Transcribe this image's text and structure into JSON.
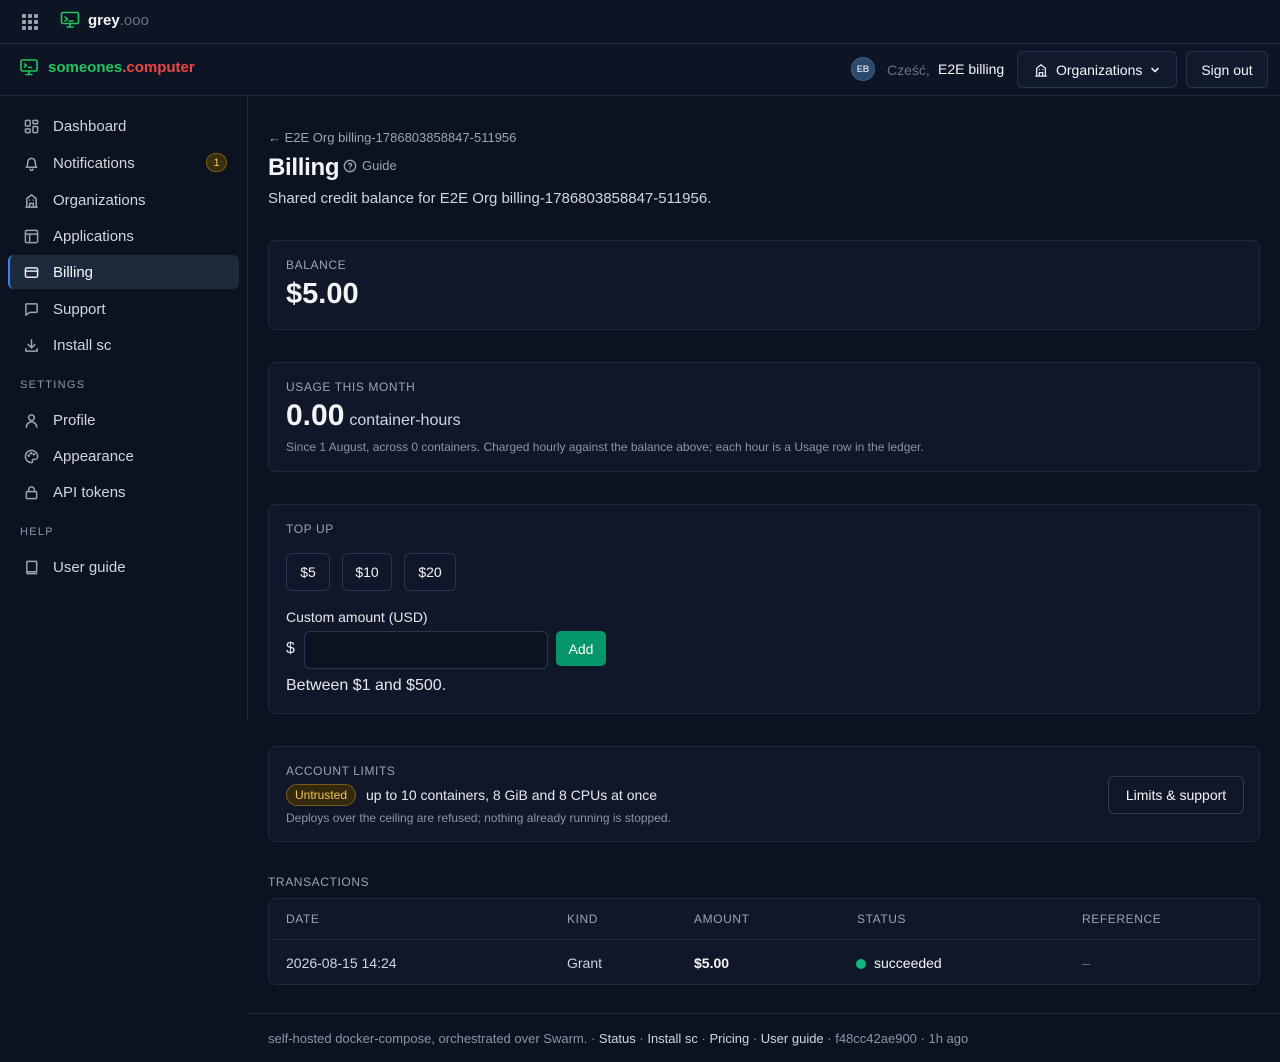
{
  "topbar": {
    "brand_name": "grey",
    "brand_tld": ".ooo"
  },
  "header": {
    "brand_part1": "someones",
    "brand_dot": ".",
    "brand_part2": "computer",
    "avatar_initials": "EB",
    "greeting": "Cześć,",
    "user_name": "E2E billing",
    "organizations_label": "Organizations",
    "sign_out_label": "Sign out"
  },
  "sidebar": {
    "items": [
      {
        "label": "Dashboard",
        "icon": "dashboard-icon"
      },
      {
        "label": "Notifications",
        "icon": "bell-icon",
        "badge": "1"
      },
      {
        "label": "Organizations",
        "icon": "building-icon"
      },
      {
        "label": "Applications",
        "icon": "layout-icon"
      },
      {
        "label": "Billing",
        "icon": "credit-card-icon",
        "active": true
      },
      {
        "label": "Support",
        "icon": "message-icon"
      },
      {
        "label": "Install sc",
        "icon": "download-icon"
      }
    ],
    "settings_heading": "SETTINGS",
    "settings_items": [
      {
        "label": "Profile",
        "icon": "user-icon"
      },
      {
        "label": "Appearance",
        "icon": "palette-icon"
      },
      {
        "label": "API tokens",
        "icon": "lock-icon"
      }
    ],
    "help_heading": "HELP",
    "help_items": [
      {
        "label": "User guide",
        "icon": "book-icon"
      }
    ]
  },
  "page": {
    "back_link": "← E2E Org billing-1786803858847-511956",
    "title": "Billing",
    "guide_label": "Guide",
    "subtitle": "Shared credit balance for E2E Org billing-1786803858847-511956."
  },
  "balance": {
    "label": "BALANCE",
    "amount": "$5.00"
  },
  "usage": {
    "label": "USAGE THIS MONTH",
    "value": "0.00",
    "unit": "container-hours",
    "note": "Since 1 August, across 0 containers. Charged hourly against the balance above; each hour is a Usage row in the ledger."
  },
  "topup": {
    "label": "TOP UP",
    "amounts": [
      "$5",
      "$10",
      "$20"
    ],
    "custom_label": "Custom amount (USD)",
    "currency_symbol": "$",
    "input_value": "",
    "add_label": "Add",
    "range_note": "Between $1 and $500."
  },
  "limits": {
    "label": "ACCOUNT LIMITS",
    "badge": "Untrusted",
    "text": "up to 10 containers, 8 GiB and 8 CPUs at once",
    "note": "Deploys over the ceiling are refused; nothing already running is stopped.",
    "button_label": "Limits & support"
  },
  "transactions": {
    "heading": "TRANSACTIONS",
    "columns": [
      "DATE",
      "KIND",
      "AMOUNT",
      "STATUS",
      "REFERENCE"
    ],
    "rows": [
      {
        "date": "2026-08-15 14:24",
        "kind": "Grant",
        "amount": "$5.00",
        "status": "succeeded",
        "reference": "–"
      }
    ]
  },
  "footer": {
    "text": "self-hosted docker-compose, orchestrated over Swarm.",
    "sep": " · ",
    "links": [
      "Status",
      "Install sc",
      "Pricing",
      "User guide"
    ],
    "commit": "f48cc42ae900",
    "age": "1h ago"
  },
  "colors": {
    "accent_green": "#059669",
    "brand_green": "#22c55e",
    "brand_red": "#ef4444",
    "warning": "#f5c451"
  }
}
